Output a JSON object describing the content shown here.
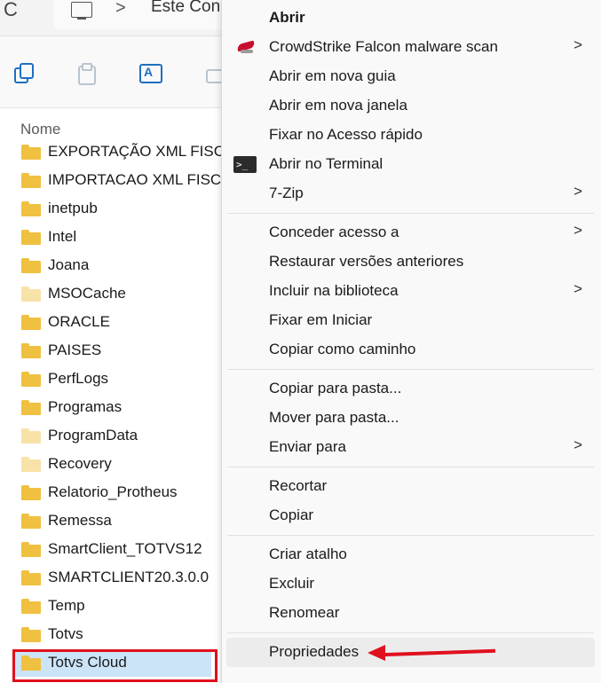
{
  "explorer": {
    "refresh_glyph": "C",
    "breadcrumb_text": "Este Con",
    "breadcrumb_chevron": ">",
    "column_header": "Nome",
    "folders": [
      {
        "name": "EXPORTAÇÃO XML FISCA",
        "color": "#f0c040"
      },
      {
        "name": "IMPORTACAO XML FISCA",
        "color": "#f0c040"
      },
      {
        "name": "inetpub",
        "color": "#f0c040"
      },
      {
        "name": "Intel",
        "color": "#f0c040"
      },
      {
        "name": "Joana",
        "color": "#f0c040"
      },
      {
        "name": "MSOCache",
        "color": "#f7e2a8"
      },
      {
        "name": "ORACLE",
        "color": "#f0c040"
      },
      {
        "name": "PAISES",
        "color": "#f0c040"
      },
      {
        "name": "PerfLogs",
        "color": "#f0c040"
      },
      {
        "name": "Programas",
        "color": "#f0c040"
      },
      {
        "name": "ProgramData",
        "color": "#f7e2a8"
      },
      {
        "name": "Recovery",
        "color": "#f7e2a8"
      },
      {
        "name": "Relatorio_Protheus",
        "color": "#f0c040"
      },
      {
        "name": "Remessa",
        "color": "#f0c040"
      },
      {
        "name": "SmartClient_TOTVS12",
        "color": "#f0c040"
      },
      {
        "name": "SMARTCLIENT20.3.0.0",
        "color": "#f0c040"
      },
      {
        "name": "Temp",
        "color": "#f0c040"
      },
      {
        "name": "Totvs",
        "color": "#f0c040"
      },
      {
        "name": "Totvs Cloud",
        "color": "#f0c040"
      }
    ],
    "selected_folder": "Totvs Cloud",
    "selection_color": "#cce4f7",
    "highlight_color": "#e0101d"
  },
  "context_menu": {
    "groups": [
      [
        {
          "label": "Abrir",
          "bold": true
        },
        {
          "label": "CrowdStrike Falcon malware scan",
          "icon": "crowdstrike-icon",
          "submenu": true
        },
        {
          "label": "Abrir em nova guia"
        },
        {
          "label": "Abrir em nova janela"
        },
        {
          "label": "Fixar no Acesso rápido"
        },
        {
          "label": "Abrir no Terminal",
          "icon": "terminal-icon"
        },
        {
          "label": "7-Zip",
          "submenu": true
        }
      ],
      [
        {
          "label": "Conceder acesso a",
          "submenu": true
        },
        {
          "label": "Restaurar versões anteriores"
        },
        {
          "label": "Incluir na biblioteca",
          "submenu": true
        },
        {
          "label": "Fixar em Iniciar"
        },
        {
          "label": "Copiar como caminho"
        }
      ],
      [
        {
          "label": "Copiar para pasta..."
        },
        {
          "label": "Mover para pasta..."
        },
        {
          "label": "Enviar para",
          "submenu": true
        }
      ],
      [
        {
          "label": "Recortar"
        },
        {
          "label": "Copiar"
        }
      ],
      [
        {
          "label": "Criar atalho"
        },
        {
          "label": "Excluir"
        },
        {
          "label": "Renomear"
        }
      ],
      [
        {
          "label": "Propriedades",
          "hover": true
        }
      ]
    ],
    "submenu_chevron": ">",
    "terminal_glyph": ">_"
  },
  "annotation": {
    "arrow_color": "#e0101d",
    "arrow_target": "Propriedades"
  }
}
